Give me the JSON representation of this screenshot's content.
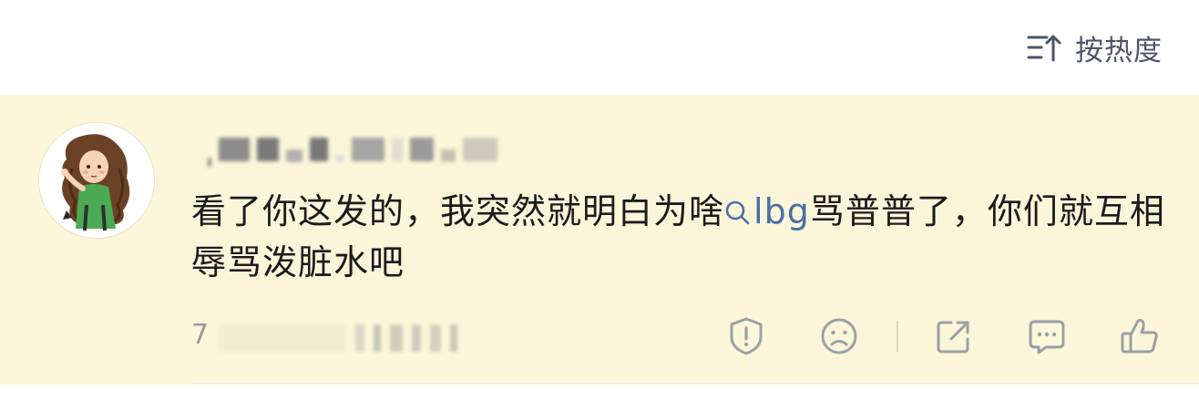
{
  "sort": {
    "label": "按热度",
    "icon": "sort-desc-icon"
  },
  "comment": {
    "avatar_icon": "avatar-girl-curly-hair",
    "username_blurred": true,
    "text_before": "看了你这发的，我突然就明白为啥",
    "search_link": "lbg",
    "text_after": "骂普普了，你们就互相辱骂泼脏水吧",
    "like_count": "7",
    "colors": {
      "background": "#fbf6d9",
      "link": "#4a6fa5",
      "icon": "#9aa0a6"
    }
  },
  "actions": [
    {
      "name": "report-icon"
    },
    {
      "name": "dislike-icon"
    },
    {
      "name": "share-icon"
    },
    {
      "name": "reply-icon"
    },
    {
      "name": "like-icon"
    }
  ]
}
